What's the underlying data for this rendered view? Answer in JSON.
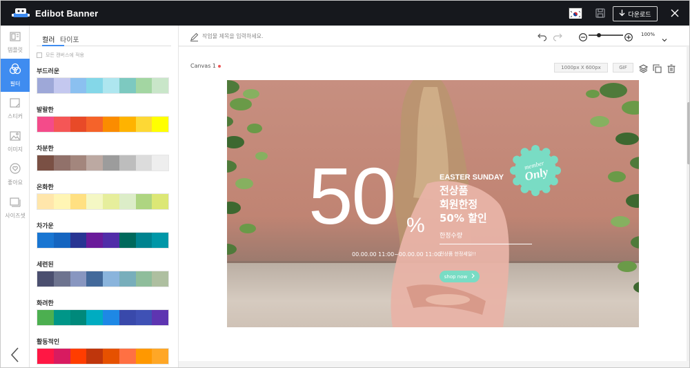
{
  "app": {
    "brand_name": "Edibot Banner",
    "download_label": "다운로드"
  },
  "rail": {
    "items": [
      {
        "label": "템플릿",
        "icon": "template-icon"
      },
      {
        "label": "필터",
        "icon": "filter-icon"
      },
      {
        "label": "스티커",
        "icon": "sticker-icon"
      },
      {
        "label": "이미지",
        "icon": "image-icon"
      },
      {
        "label": "좋아요",
        "icon": "like-icon"
      },
      {
        "label": "사이즈셋",
        "icon": "size-set-icon"
      }
    ],
    "active_index": 1
  },
  "panel": {
    "tabs": [
      "컬러",
      "타이포"
    ],
    "active_tab": 0,
    "apply_all_label": "모든 캔버스에 적용",
    "groups": [
      {
        "name": "부드러운",
        "colors": [
          "#9ea8d8",
          "#c4c8ef",
          "#8bc0f0",
          "#84d7e8",
          "#aee6ef",
          "#7dc9c0",
          "#a3d6a2",
          "#c9e6c9"
        ]
      },
      {
        "name": "발랄한",
        "colors": [
          "#f44b8a",
          "#f55656",
          "#e84a28",
          "#f5632a",
          "#fb8c00",
          "#ffb300",
          "#fdd835",
          "#ffff00"
        ]
      },
      {
        "name": "차분한",
        "colors": [
          "#7a5044",
          "#91716a",
          "#a3867d",
          "#bca9a2",
          "#9c9c9c",
          "#bdbdbd",
          "#dcdcdc",
          "#eeeeee"
        ]
      },
      {
        "name": "온화한",
        "colors": [
          "#ffe6ab",
          "#fff5b4",
          "#ffe082",
          "#f4f7c4",
          "#e6ee9c",
          "#dcedc8",
          "#aed581",
          "#dce775"
        ]
      },
      {
        "name": "차가운",
        "colors": [
          "#1976d2",
          "#1565c0",
          "#283593",
          "#6a1b9a",
          "#512da8",
          "#00695c",
          "#00838f",
          "#0097a7"
        ]
      },
      {
        "name": "세련된",
        "colors": [
          "#4b4f6f",
          "#6e748f",
          "#8896c0",
          "#43699a",
          "#8ab4dc",
          "#78aebb",
          "#8fbd9b",
          "#aebfa0"
        ]
      },
      {
        "name": "화려한",
        "colors": [
          "#4caf50",
          "#009688",
          "#00897b",
          "#00acc1",
          "#1e88e5",
          "#3949ab",
          "#3f51b5",
          "#5e35b1"
        ]
      },
      {
        "name": "활동적인",
        "colors": [
          "#ff1744",
          "#d81b60",
          "#ff3d00",
          "#bf360c",
          "#e65100",
          "#ff7043",
          "#ff9800",
          "#ffa726"
        ]
      }
    ]
  },
  "work": {
    "title_placeholder": "작업물 제목을 입력하세요.",
    "zoom_value": "100%",
    "zoom_level": 0.3,
    "canvas_name": "Canvas 1",
    "canvas_size": "1000px X 600px",
    "gif_label": "GIF"
  },
  "banner": {
    "big_number": "50",
    "percent_sign": "%",
    "date_range": "00.00.00 11:00~00.00.00 11:00",
    "easter": "EASTER SUNDAY",
    "headline": [
      "전상품",
      "회원한정",
      "50% 할인"
    ],
    "limited": "한정수량",
    "small_note": "전상품 한정세일!!",
    "shop_label": "shop now",
    "badge_member": "member",
    "badge_only": "Only",
    "accent_color": "#79dcc4"
  }
}
